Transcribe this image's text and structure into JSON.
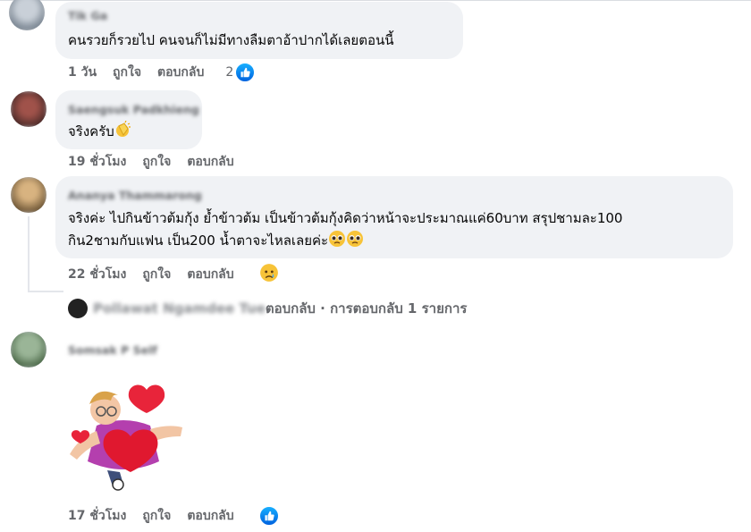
{
  "comments": [
    {
      "author": "Tik Ga",
      "text": "คนรวยก็รวยไป คนจนก็ไม่มีทางลืมตาอ้าปากได้เลยตอนนี้",
      "time": "1 วัน",
      "like_label": "ถูกใจ",
      "reply_label": "ตอบกลับ",
      "reaction_count": "2"
    },
    {
      "author": "Saengsuk Padkhieng",
      "text": "จริงครับ",
      "time": "19 ชั่วโมง",
      "like_label": "ถูกใจ",
      "reply_label": "ตอบกลับ"
    },
    {
      "author": "Ananya Thammarong",
      "text_line1": "จริงค่ะ ไปกินข้าวต้มกุ้ง ย้ำข้าวต้ม เป็นข้าวต้มกุ้งคิดว่าหน้าจะประมาณแค่60บาท สรุปชามละ100",
      "text_line2": "กิน2ชามกับแฟน เป็น200 น้ำตาจะไหลเลยค่ะ",
      "time": "22 ชั่วโมง",
      "like_label": "ถูกใจ",
      "reply_label": "ตอบกลับ",
      "replies": {
        "replier": "Pollawat Ngamdee Tue",
        "text": "ตอบกลับ · การตอบกลับ 1 รายการ"
      }
    },
    {
      "author": "Somsak P Self",
      "sticker": "avatar-heart-sticker",
      "time": "17 ชั่วโมง",
      "like_label": "ถูกใจ",
      "reply_label": "ตอบกลับ"
    }
  ],
  "colors": {
    "bubble": "#f0f2f5",
    "meta_text": "#65676b",
    "like_blue": "#1877f2"
  }
}
